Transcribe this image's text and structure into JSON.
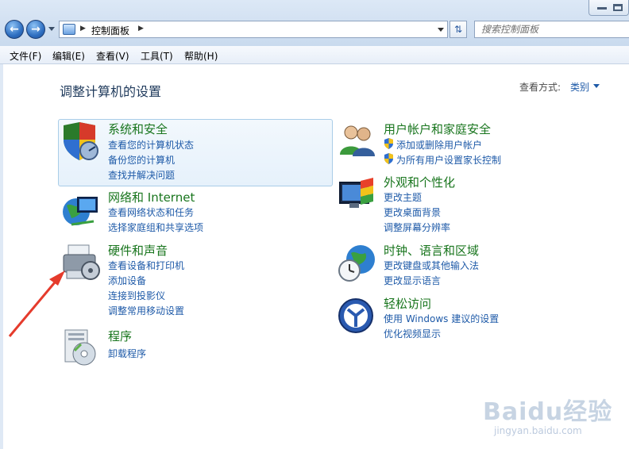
{
  "search": {
    "placeholder": "搜索控制面板"
  },
  "address": {
    "path": "控制面板"
  },
  "menu": [
    "文件(F)",
    "编辑(E)",
    "查看(V)",
    "工具(T)",
    "帮助(H)"
  ],
  "page_title": "调整计算机的设置",
  "view": {
    "label": "查看方式:",
    "value": "类别"
  },
  "categories": [
    {
      "title": "系统和安全",
      "links": [
        "查看您的计算机状态",
        "备份您的计算机",
        "查找并解决问题"
      ]
    },
    {
      "title": "网络和 Internet",
      "links": [
        "查看网络状态和任务",
        "选择家庭组和共享选项"
      ]
    },
    {
      "title": "硬件和声音",
      "links": [
        "查看设备和打印机",
        "添加设备",
        "连接到投影仪",
        "调整常用移动设置"
      ]
    },
    {
      "title": "程序",
      "links": [
        "卸载程序"
      ]
    },
    {
      "title": "用户帐户和家庭安全",
      "links": [
        "添加或删除用户帐户",
        "为所有用户设置家长控制"
      ]
    },
    {
      "title": "外观和个性化",
      "links": [
        "更改主题",
        "更改桌面背景",
        "调整屏幕分辨率"
      ]
    },
    {
      "title": "时钟、语言和区域",
      "links": [
        "更改键盘或其他输入法",
        "更改显示语言"
      ]
    },
    {
      "title": "轻松访问",
      "links": [
        "使用 Windows 建议的设置",
        "优化视频显示"
      ]
    }
  ],
  "watermark": {
    "brand": "Baidu经验",
    "url": "jingyan.baidu.com"
  },
  "colors": {
    "link": "#1e5aa8",
    "category_title": "#18751d",
    "arrow": "#e53b2c"
  }
}
